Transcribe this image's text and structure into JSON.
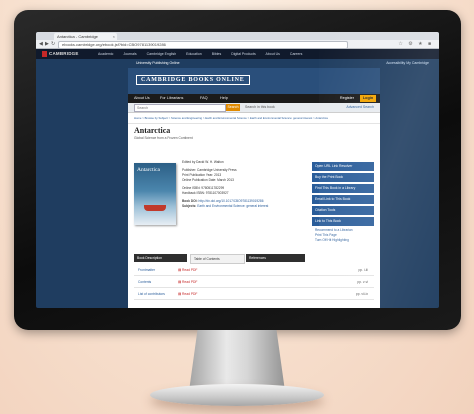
{
  "browser": {
    "tab_title": "Antarctica - Cambridge",
    "url": "ebooks.cambridge.org/ebook.jsf?bid=CBO9781139019286"
  },
  "site": {
    "logo": "CAMBRIDGE",
    "logo_sub": "UNIVERSITY PRESS",
    "topnav": [
      "Academic",
      "Journals",
      "Cambridge English",
      "Education",
      "Bibles",
      "Digital Products",
      "About Us",
      "Careers"
    ],
    "subnav_left": "University Publishing Online",
    "subnav_right": "Accessibility   My Cambridge"
  },
  "cbo": {
    "logo": "CAMBRIDGE BOOKS ONLINE",
    "menu": [
      "About Us",
      "For Librarians",
      "FAQ",
      "Help"
    ],
    "register": "Register",
    "login": "Login",
    "search_placeholder": "Search",
    "search_button": "Search",
    "search_scope": "Search in this book",
    "advanced_search": "Advanced Search",
    "breadcrumb": "Home > Browse by Subject > Science and Engineering > Earth and Environmental Science > Earth and Environmental Science: general interest > Antarctica"
  },
  "book": {
    "title": "Antarctica",
    "subtitle": "Global Science from a Frozen Continent",
    "cover_title": "Antarctica",
    "edited_by": "Edited by David W. H. Walton",
    "publisher": "Publisher: Cambridge University Press",
    "print_date": "Print Publication Year: 2013",
    "online_date": "Online Publication Date: March 2013",
    "online_isbn": "Online ISBN: 9780511782299",
    "hardback_isbn": "Hardback ISBN: 9781107003927",
    "doi_label": "Book DOI:",
    "doi": "http://dx.doi.org/10.1017/CBO9781139019286",
    "subjects_label": "Subjects:",
    "subjects": "Earth and Environmental Science: general interest"
  },
  "sidebar": {
    "buttons": [
      "Open URL Link Resolver",
      "Buy the Print Book",
      "Find This Book in a Library",
      "Email Link to This Book",
      "Citation Tools",
      "Link to This Book"
    ],
    "links": [
      "Recommend to a Librarian",
      "Print This Page",
      "Turn Off Hit Highlighting"
    ]
  },
  "content_tabs": [
    "Book Description",
    "Table of Contents",
    "References"
  ],
  "toc": [
    {
      "name": "Frontmatter",
      "pdf": "Read PDF",
      "pages": "pp. i-iii"
    },
    {
      "name": "Contents",
      "pdf": "Read PDF",
      "pages": "pp. v-vi"
    },
    {
      "name": "List of contributors",
      "pdf": "Read PDF",
      "pages": "pp. vii-ix"
    }
  ]
}
